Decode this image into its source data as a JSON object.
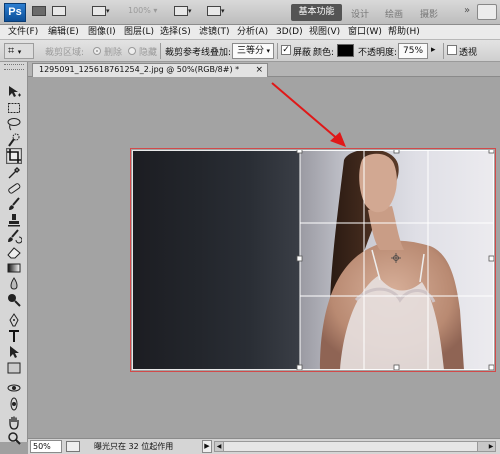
{
  "app": {
    "logo": "Ps",
    "zoom": "100%",
    "workspaces": [
      "基本功能",
      "设计",
      "绘画",
      "摄影"
    ],
    "active_workspace": "基本功能",
    "more": "»"
  },
  "menu": [
    "文件(F)",
    "编辑(E)",
    "图像(I)",
    "图层(L)",
    "选择(S)",
    "滤镜(T)",
    "分析(A)",
    "3D(D)",
    "视图(V)",
    "窗口(W)",
    "帮助(H)"
  ],
  "options": {
    "crop_area": "裁剪区域:",
    "delete": "删除",
    "hide": "隐藏",
    "overlay_label": "裁剪参考线叠加:",
    "overlay_value": "三等分",
    "shield": "屏蔽",
    "shield_checked": true,
    "color_label": "颜色:",
    "color_value": "#000000",
    "opacity_label": "不透明度:",
    "opacity_value": "75%",
    "perspective": "透视",
    "perspective_checked": false
  },
  "document": {
    "tab_title": "1295091_1256187612​54_2.jpg @ 50%(RGB/8#) *",
    "close": "×"
  },
  "statusbar": {
    "zoom": "50%",
    "info": "曝光只在 32 位起作用",
    "arrow": "▶"
  },
  "tools": [
    "move-tool",
    "marquee-tool",
    "lasso-tool",
    "quick-selection-tool",
    "crop-tool",
    "eyedropper-tool",
    "spot-healing-tool",
    "brush-tool",
    "clone-stamp-tool",
    "history-brush-tool",
    "eraser-tool",
    "gradient-tool",
    "blur-tool",
    "dodge-tool",
    "pen-tool",
    "type-tool",
    "path-selection-tool",
    "shape-tool",
    "3d-rotate-tool",
    "3d-orbit-tool",
    "hand-tool",
    "zoom-tool"
  ],
  "colors": {
    "active_workspace_bg": "#545454",
    "crop_shield_border": "#d24a4a",
    "annotation_arrow": "#e01818",
    "guide_lines": "#ffffff"
  }
}
